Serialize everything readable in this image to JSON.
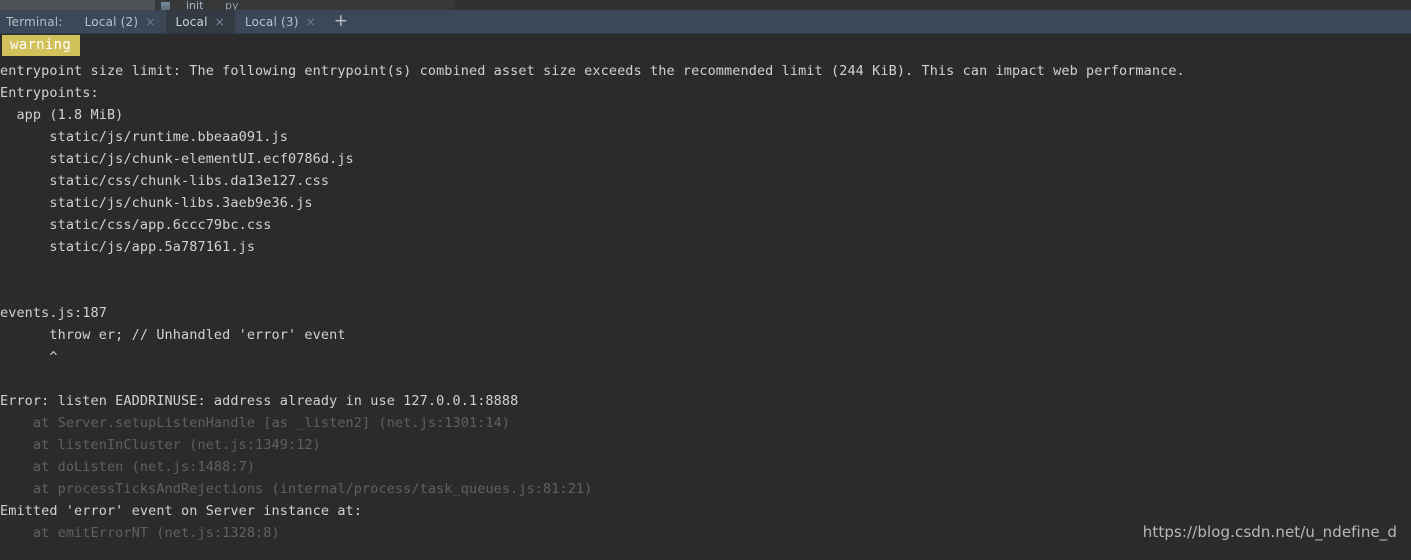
{
  "editor_strip": {
    "fragment_primary": "init",
    "fragment_secondary": "py",
    "file_icon": "js-file-icon"
  },
  "terminal": {
    "label": "Terminal:",
    "tabs": [
      {
        "name": "Local (2)",
        "close": "×",
        "active": false
      },
      {
        "name": "Local",
        "close": "×",
        "active": true
      },
      {
        "name": "Local (3)",
        "close": "×",
        "active": false
      }
    ],
    "add_tab_label": "+",
    "colors": {
      "tabbar_bg": "#3c4858",
      "active_tab_bg": "#333a44",
      "console_bg": "#2b2b2b",
      "text": "#cfd2d4",
      "dim_text": "#5e6163",
      "warning_bg": "#d2c15b",
      "warning_text": "#ffffff"
    }
  },
  "warning": {
    "badge_label": "warning"
  },
  "output": {
    "lines": [
      {
        "text": "entrypoint size limit: The following entrypoint(s) combined asset size exceeds the recommended limit (244 KiB). This can impact web performance.",
        "dim": false
      },
      {
        "text": "Entrypoints:",
        "dim": false
      },
      {
        "text": "  app (1.8 MiB)",
        "dim": false
      },
      {
        "text": "      static/js/runtime.bbeaa091.js",
        "dim": false
      },
      {
        "text": "      static/js/chunk-elementUI.ecf0786d.js",
        "dim": false
      },
      {
        "text": "      static/css/chunk-libs.da13e127.css",
        "dim": false
      },
      {
        "text": "      static/js/chunk-libs.3aeb9e36.js",
        "dim": false
      },
      {
        "text": "      static/css/app.6ccc79bc.css",
        "dim": false
      },
      {
        "text": "      static/js/app.5a787161.js",
        "dim": false
      },
      {
        "text": "",
        "dim": false
      },
      {
        "text": "",
        "dim": false
      },
      {
        "text": "events.js:187",
        "dim": false
      },
      {
        "text": "      throw er; // Unhandled 'error' event",
        "dim": false
      },
      {
        "text": "      ^",
        "dim": false
      },
      {
        "text": "",
        "dim": false
      },
      {
        "text": "Error: listen EADDRINUSE: address already in use 127.0.0.1:8888",
        "dim": false
      },
      {
        "text": "    at Server.setupListenHandle [as _listen2] (net.js:1301:14)",
        "dim": true
      },
      {
        "text": "    at listenInCluster (net.js:1349:12)",
        "dim": true
      },
      {
        "text": "    at doListen (net.js:1488:7)",
        "dim": true
      },
      {
        "text": "    at processTicksAndRejections (internal/process/task_queues.js:81:21)",
        "dim": true
      },
      {
        "text": "Emitted 'error' event on Server instance at:",
        "dim": false
      },
      {
        "text": "    at emitErrorNT (net.js:1328:8)",
        "dim": true
      }
    ]
  },
  "watermark": {
    "url": "https://blog.csdn.net/u_ndefine_d"
  }
}
